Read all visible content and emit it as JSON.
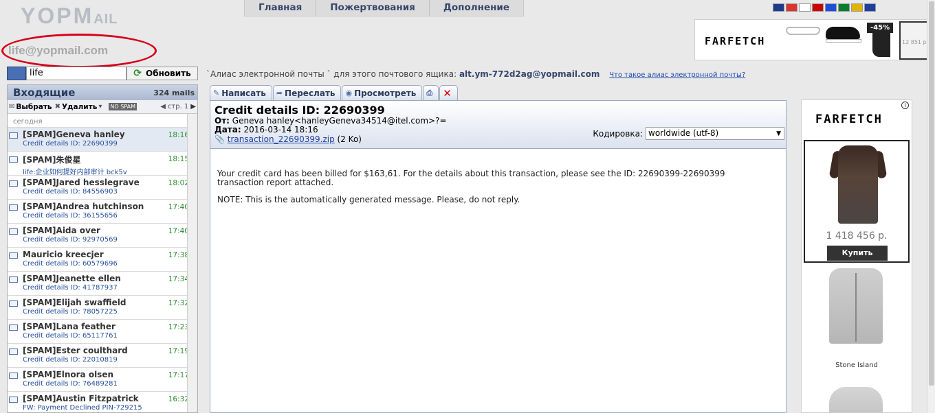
{
  "logo": {
    "main": "YOPM",
    "tail": "AIL"
  },
  "nav": {
    "items": [
      "Главная",
      "Пожертвования",
      "Дополнение"
    ]
  },
  "flags": [
    "#1e3a8a",
    "#d33",
    "#fff",
    "#c00",
    "#1d4ed8",
    "#0a7d2c",
    "#e0b400",
    "#1f3fa0"
  ],
  "mailbox": {
    "address": "life@yopmail.com"
  },
  "search": {
    "value": "life",
    "refresh_label": "Обновить"
  },
  "alias": {
    "prefix": "`Алиас электронной почты ` для этого почтового ящика:",
    "address": "alt.ym-772d2ag",
    "domain": "@yopmail.com",
    "link": "Что такое алиас электронной почты?"
  },
  "top_ad": {
    "brand": "FARFETCH",
    "discount": "-45%",
    "tile_price": "12 851 р"
  },
  "inbox": {
    "title": "Входящие",
    "count": "324 mails",
    "select_label": "Выбрать",
    "delete_label": "Удалить",
    "nospam_label": "NO SPAM",
    "page_label": "стр. 1",
    "day_label": "сегодня",
    "mails": [
      {
        "sender": "[SPAM]Geneva hanley",
        "time": "18:16",
        "subject": "Credit details ID: 22690399"
      },
      {
        "sender": "[SPAM]朱俊星",
        "time": "18:15",
        "subject": "life:企业如何提好内部审计 bck5v"
      },
      {
        "sender": "[SPAM]Jared hesslegrave",
        "time": "18:02",
        "subject": "Credit details ID: 84556903"
      },
      {
        "sender": "[SPAM]Andrea hutchinson",
        "time": "17:40",
        "subject": "Credit details ID: 36155656"
      },
      {
        "sender": "[SPAM]Aida over",
        "time": "17:40",
        "subject": "Credit details ID: 92970569"
      },
      {
        "sender": "Mauricio kreecjer",
        "time": "17:38",
        "subject": "Credit details ID: 60579696"
      },
      {
        "sender": "[SPAM]Jeanette ellen",
        "time": "17:34",
        "subject": "Credit details ID: 41787937"
      },
      {
        "sender": "[SPAM]Elijah swaffield",
        "time": "17:32",
        "subject": "Credit details ID: 78057225"
      },
      {
        "sender": "[SPAM]Lana feather",
        "time": "17:23",
        "subject": "Credit details ID: 65117761"
      },
      {
        "sender": "[SPAM]Ester coulthard",
        "time": "17:19",
        "subject": "Credit details ID: 22010819"
      },
      {
        "sender": "[SPAM]Elnora olsen",
        "time": "17:17",
        "subject": "Credit details ID: 76489281"
      },
      {
        "sender": "[SPAM]Austin Fitzpatrick",
        "time": "16:32",
        "subject": "FW: Payment Declined PIN-729215"
      }
    ]
  },
  "tabs": {
    "write": "Написать",
    "forward": "Переслать",
    "view": "Просмотреть"
  },
  "message": {
    "title": "Credit details ID: 22690399",
    "from_label": "От:",
    "from_value": "Geneva hanley<hanleyGeneva34514@itel.com>?=",
    "date_label": "Дата:",
    "date_value": "2016-03-14 18:16",
    "attachment_name": "transaction_22690399.zip",
    "attachment_size": "(2 Ko)",
    "encoding_label": "Кодировка:",
    "encoding_value": "worldwide (utf-8)",
    "body_1": "Your credit card has been billed for $163,61. For the details about this transaction, please see the ID: 22690399-22690399 transaction report attached.",
    "body_2": "NOTE: This is the automatically generated message. Please, do not reply."
  },
  "side_ad": {
    "brand": "FARFETCH",
    "price": "1 418 456 р.",
    "buy_label": "Купить",
    "brand_name": "Stone Island"
  }
}
